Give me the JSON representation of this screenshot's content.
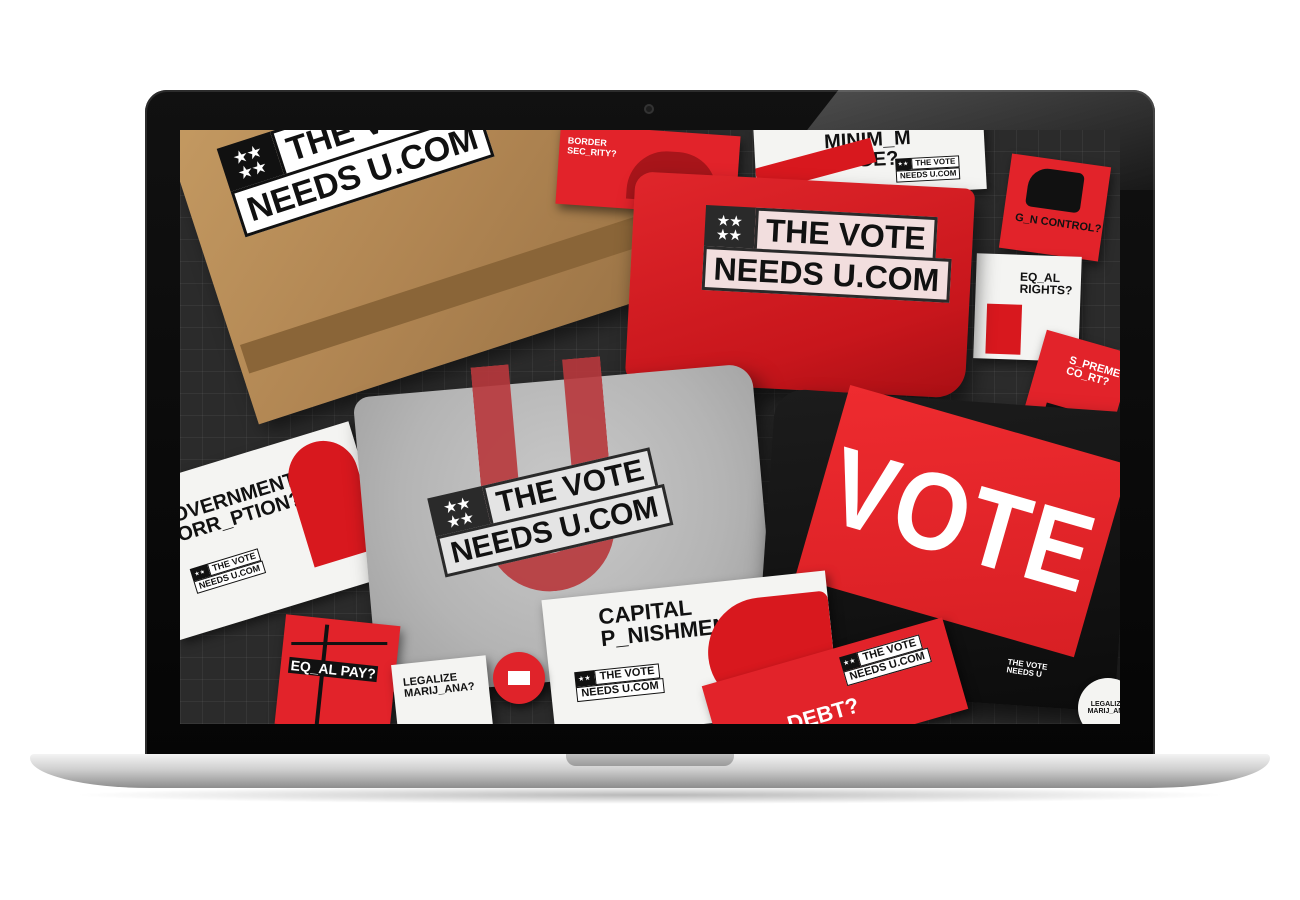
{
  "brand": {
    "line1": "THE VOTE",
    "line2": "NEEDS U.COM",
    "stars": "★★\n★★"
  },
  "shirts": {
    "black_word": "VOTE",
    "black_tag_line1": "THE VOTE",
    "black_tag_line2": "NEEDS U"
  },
  "stickers": {
    "government": "GOVERNMENT\nCORR_PTION?",
    "capital": "CAPITAL\nP_NISHMENT?",
    "equal_pay": "EQ_AL PAY?",
    "legalize": "LEGALIZE\nMARIJ_ANA?",
    "minimum_wage": "MINIM_M WAGE?",
    "gun_control": "G_N CONTROL?",
    "equal_rights": "EQ_AL\nRIGHTS?",
    "supreme": "S_PREME\nCO_RT?",
    "border": "BORDER\nSEC_RITY?",
    "debt": "_DEBT?",
    "legalize_button": "LEGALIZE\nMARIJ_ANA"
  },
  "colors": {
    "red": "#e2232a",
    "dark": "#2b2b2b",
    "cardboard": "#b08552",
    "grey_shirt": "#b4b4b4"
  }
}
